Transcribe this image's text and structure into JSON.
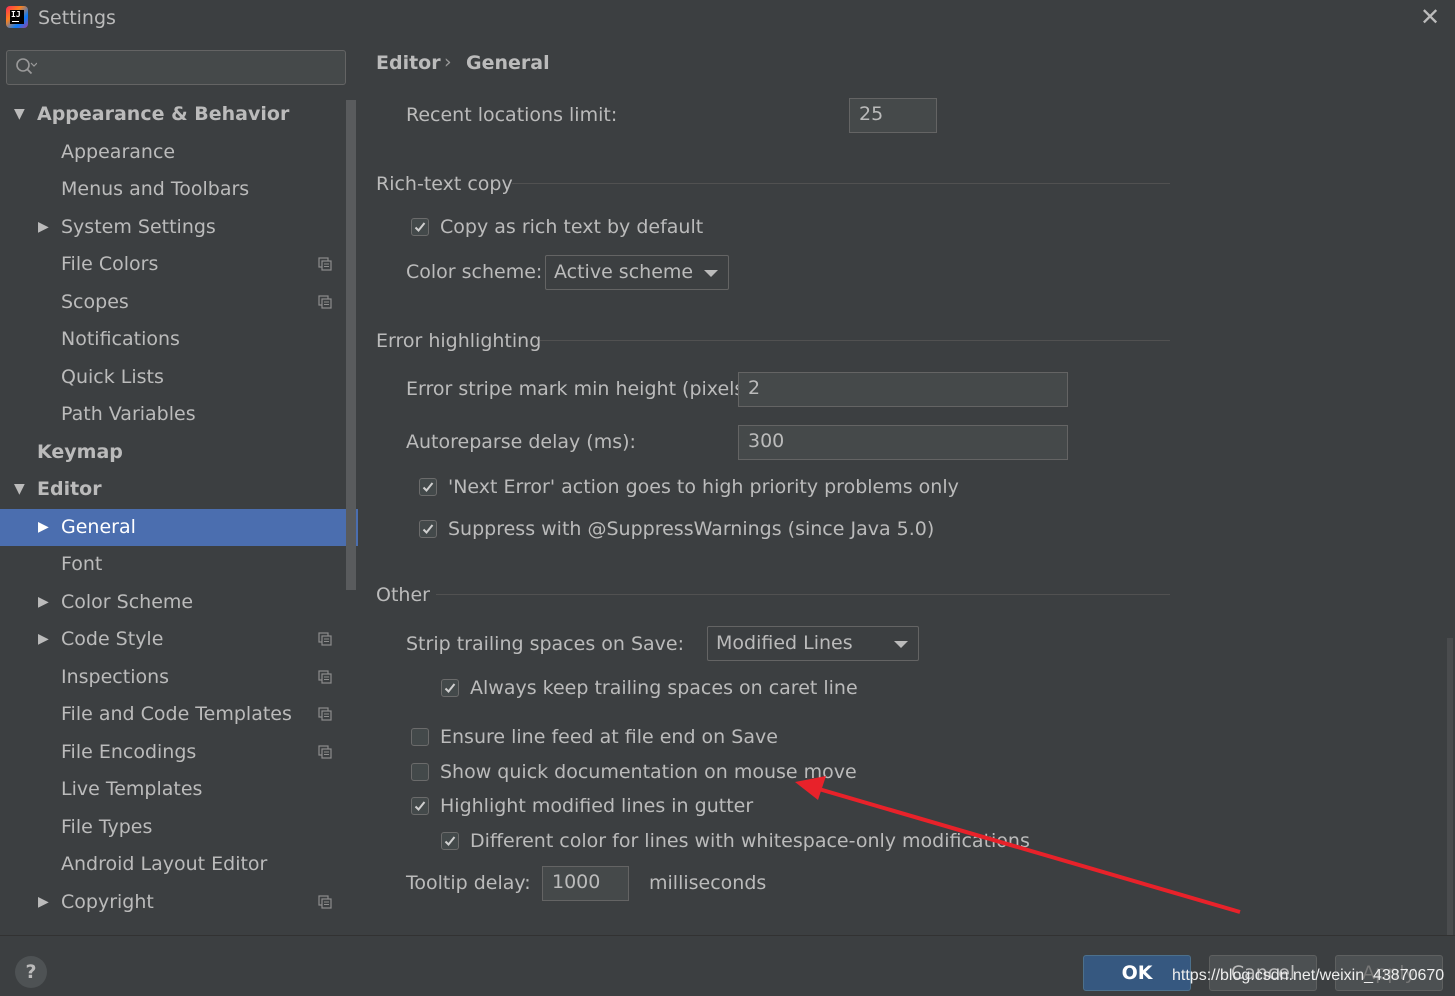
{
  "window": {
    "title": "Settings",
    "close_glyph": "✕"
  },
  "search": {
    "placeholder": ""
  },
  "sidebar": {
    "items": [
      {
        "label": "Appearance & Behavior",
        "level": 0,
        "expander": "expanded",
        "bold": true
      },
      {
        "label": "Appearance",
        "level": 1,
        "expander": "none"
      },
      {
        "label": "Menus and Toolbars",
        "level": 1,
        "expander": "none"
      },
      {
        "label": "System Settings",
        "level": 1,
        "expander": "collapsed"
      },
      {
        "label": "File Colors",
        "level": 1,
        "expander": "none",
        "project_icon": true
      },
      {
        "label": "Scopes",
        "level": 1,
        "expander": "none",
        "project_icon": true
      },
      {
        "label": "Notifications",
        "level": 1,
        "expander": "none"
      },
      {
        "label": "Quick Lists",
        "level": 1,
        "expander": "none"
      },
      {
        "label": "Path Variables",
        "level": 1,
        "expander": "none"
      },
      {
        "label": "Keymap",
        "level": 0,
        "expander": "none",
        "bold": true
      },
      {
        "label": "Editor",
        "level": 0,
        "expander": "expanded",
        "bold": true
      },
      {
        "label": "General",
        "level": 1,
        "expander": "collapsed",
        "selected": true
      },
      {
        "label": "Font",
        "level": 1,
        "expander": "none"
      },
      {
        "label": "Color Scheme",
        "level": 1,
        "expander": "collapsed"
      },
      {
        "label": "Code Style",
        "level": 1,
        "expander": "collapsed",
        "project_icon": true
      },
      {
        "label": "Inspections",
        "level": 1,
        "expander": "none",
        "project_icon": true
      },
      {
        "label": "File and Code Templates",
        "level": 1,
        "expander": "none",
        "project_icon": true
      },
      {
        "label": "File Encodings",
        "level": 1,
        "expander": "none",
        "project_icon": true
      },
      {
        "label": "Live Templates",
        "level": 1,
        "expander": "none"
      },
      {
        "label": "File Types",
        "level": 1,
        "expander": "none"
      },
      {
        "label": "Android Layout Editor",
        "level": 1,
        "expander": "none"
      },
      {
        "label": "Copyright",
        "level": 1,
        "expander": "collapsed",
        "project_icon": true
      }
    ]
  },
  "breadcrumb": {
    "parent": "Editor",
    "separator": "›",
    "current": "General"
  },
  "settings": {
    "recent_locations": {
      "label": "Recent locations limit:",
      "value": "25"
    },
    "rich_text": {
      "section": "Rich-text copy",
      "copy_rich": {
        "label": "Copy as rich text by default",
        "checked": true
      },
      "color_scheme": {
        "label": "Color scheme:",
        "value": "Active scheme"
      }
    },
    "error_highlighting": {
      "section": "Error highlighting",
      "stripe": {
        "label": "Error stripe mark min height (pixels):",
        "value": "2"
      },
      "autoreparse": {
        "label": "Autoreparse delay (ms):",
        "value": "300"
      },
      "next_error": {
        "label": "'Next Error' action goes to high priority problems only",
        "checked": true
      },
      "suppress": {
        "label": "Suppress with @SuppressWarnings (since Java 5.0)",
        "checked": true
      }
    },
    "other": {
      "section": "Other",
      "strip": {
        "label": "Strip trailing spaces on Save:",
        "value": "Modified Lines"
      },
      "keep_caret": {
        "label": "Always keep trailing spaces on caret line",
        "checked": true
      },
      "line_feed": {
        "label": "Ensure line feed at file end on Save",
        "checked": false
      },
      "quick_doc": {
        "label": "Show quick documentation on mouse move",
        "checked": false
      },
      "highlight_modified": {
        "label": "Highlight modified lines in gutter",
        "checked": true
      },
      "different_color": {
        "label": "Different color for lines with whitespace-only modifications",
        "checked": true
      },
      "tooltip": {
        "label": "Tooltip delay:",
        "value": "1000",
        "unit": "milliseconds"
      }
    }
  },
  "buttons": {
    "help": "?",
    "ok": "OK",
    "cancel": "Cancel",
    "apply": "Apply"
  },
  "watermark": "https://blog.csdn.net/weixin_43870670",
  "colors": {
    "background": "#3c3f41",
    "selection": "#4b6eaf",
    "ok_button": "#365880",
    "annotation_arrow": "#e8222a"
  },
  "icons": {
    "search": "search-icon",
    "expanded": "triangle-down-icon",
    "collapsed": "triangle-right-icon",
    "project": "project-level-icon",
    "dropdown": "chevron-down-icon"
  }
}
